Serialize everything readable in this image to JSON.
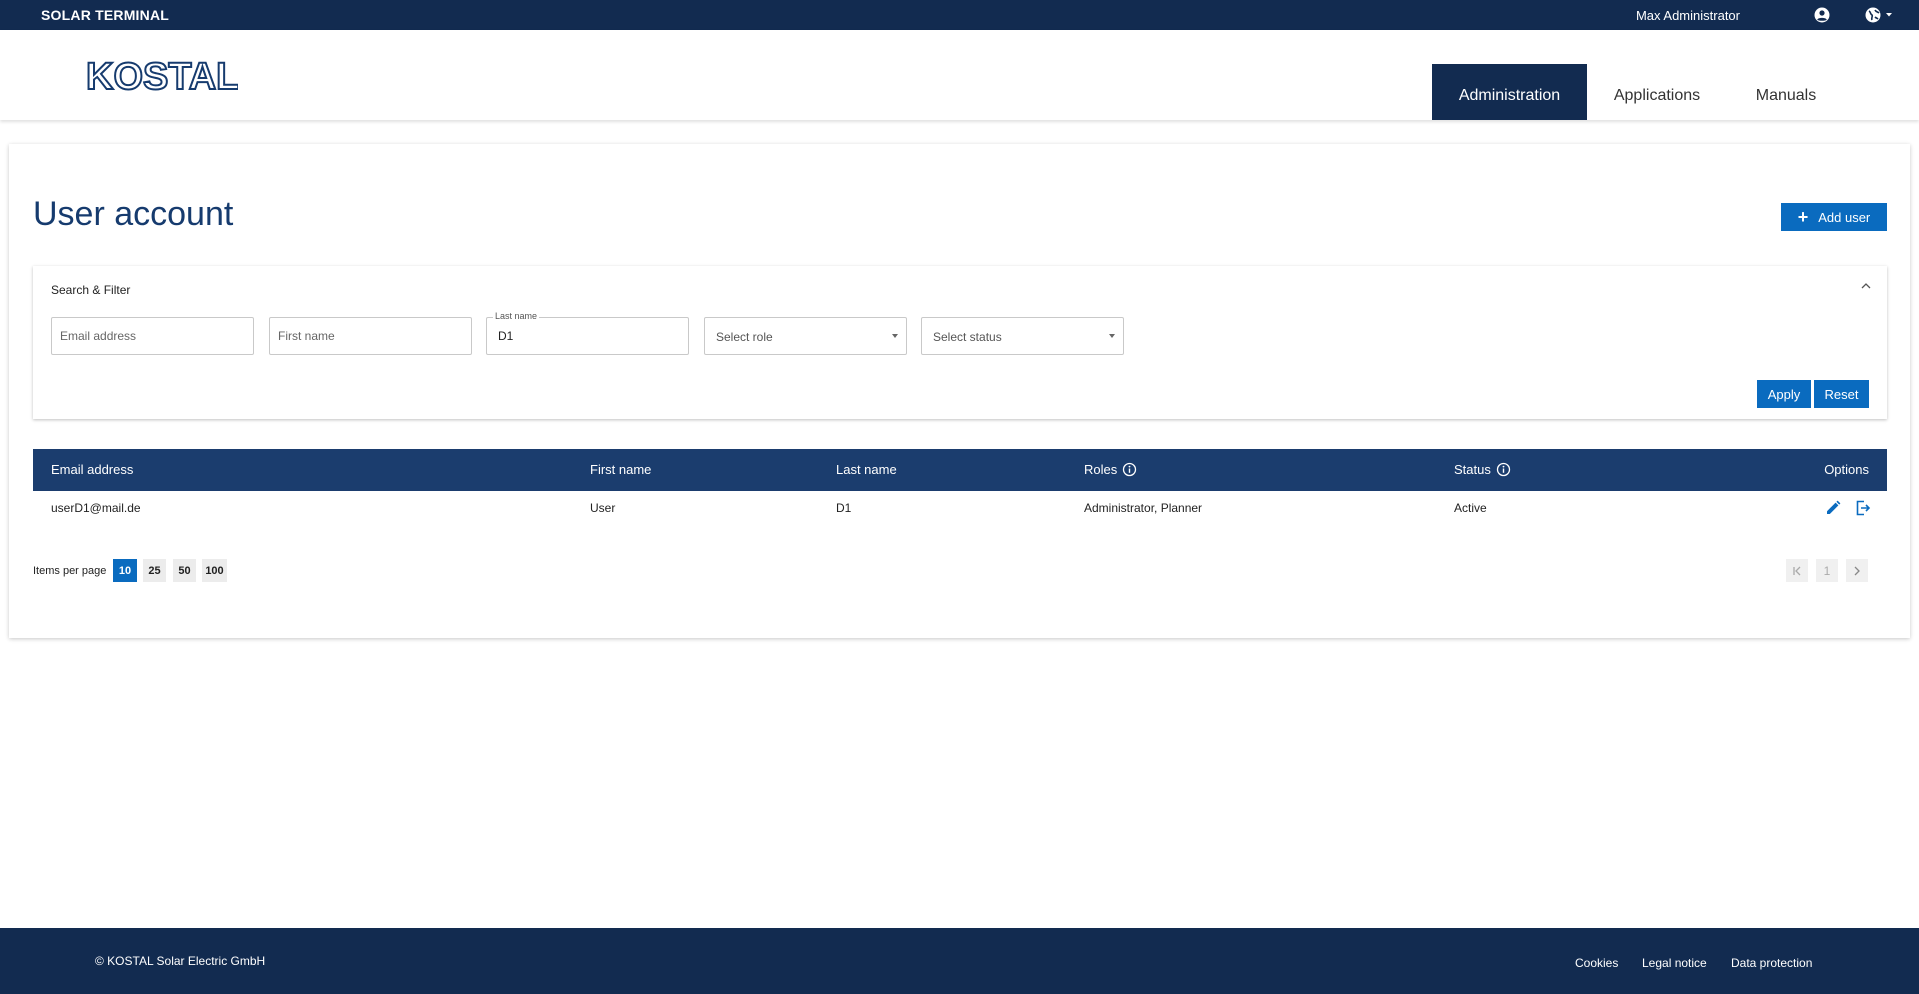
{
  "topbar": {
    "brand": "SOLAR TERMINAL",
    "user_name": "Max Administrator",
    "user_icon": "account-circle-icon",
    "language_icon": "globe-icon"
  },
  "header": {
    "logo_text": "KOSTAL",
    "nav": [
      {
        "label": "Administration",
        "active": true
      },
      {
        "label": "Applications",
        "active": false
      },
      {
        "label": "Manuals",
        "active": false
      }
    ]
  },
  "page": {
    "title": "User account",
    "add_user_label": "Add user"
  },
  "filter": {
    "title": "Search & Filter",
    "email": {
      "placeholder": "Email address",
      "value": ""
    },
    "first_name": {
      "placeholder": "First name",
      "value": ""
    },
    "last_name": {
      "label": "Last name",
      "value": "D1"
    },
    "role": {
      "placeholder": "Select role"
    },
    "status": {
      "placeholder": "Select status"
    },
    "apply_label": "Apply",
    "reset_label": "Reset"
  },
  "table": {
    "headers": {
      "email": "Email address",
      "first_name": "First name",
      "last_name": "Last name",
      "roles": "Roles",
      "status": "Status",
      "options": "Options"
    },
    "rows": [
      {
        "email": "userD1@mail.de",
        "first_name": "User",
        "last_name": "D1",
        "roles": "Administrator, Planner",
        "status": "Active"
      }
    ]
  },
  "pagination": {
    "items_per_page_label": "Items per page",
    "sizes": [
      "10",
      "25",
      "50",
      "100"
    ],
    "selected_size": "10",
    "current_page": "1"
  },
  "footer": {
    "copyright": "© KOSTAL Solar Electric GmbH",
    "links": [
      "Cookies",
      "Legal notice",
      "Data protection"
    ]
  },
  "colors": {
    "navy": "#122b50",
    "table_header": "#1b3d6e",
    "accent_blue": "#0a6bbf",
    "title_blue": "#163b6e"
  }
}
